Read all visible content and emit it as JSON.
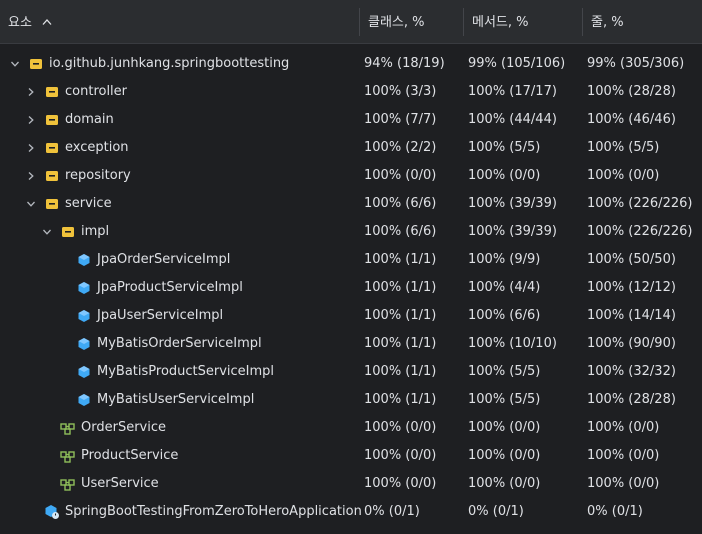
{
  "header": {
    "element_label": "요소",
    "class_label": "클래스, %",
    "method_label": "메서드, %",
    "line_label": "줄, %"
  },
  "rows": [
    {
      "label": "io.github.junhkang.springboottesting",
      "cls": "94% (18/19)",
      "meth": "99% (105/106)",
      "line": "99% (305/306)",
      "icon": "package-icon",
      "depth": 0,
      "chevron": "expanded"
    },
    {
      "label": "controller",
      "cls": "100% (3/3)",
      "meth": "100% (17/17)",
      "line": "100% (28/28)",
      "icon": "package-icon",
      "depth": 1,
      "chevron": "collapsed"
    },
    {
      "label": "domain",
      "cls": "100% (7/7)",
      "meth": "100% (44/44)",
      "line": "100% (46/46)",
      "icon": "package-icon",
      "depth": 1,
      "chevron": "collapsed"
    },
    {
      "label": "exception",
      "cls": "100% (2/2)",
      "meth": "100% (5/5)",
      "line": "100% (5/5)",
      "icon": "package-icon",
      "depth": 1,
      "chevron": "collapsed"
    },
    {
      "label": "repository",
      "cls": "100% (0/0)",
      "meth": "100% (0/0)",
      "line": "100% (0/0)",
      "icon": "package-icon",
      "depth": 1,
      "chevron": "collapsed"
    },
    {
      "label": "service",
      "cls": "100% (6/6)",
      "meth": "100% (39/39)",
      "line": "100% (226/226)",
      "icon": "package-icon",
      "depth": 1,
      "chevron": "expanded"
    },
    {
      "label": "impl",
      "cls": "100% (6/6)",
      "meth": "100% (39/39)",
      "line": "100% (226/226)",
      "icon": "package-icon",
      "depth": 2,
      "chevron": "expanded"
    },
    {
      "label": "JpaOrderServiceImpl",
      "cls": "100% (1/1)",
      "meth": "100% (9/9)",
      "line": "100% (50/50)",
      "icon": "class-icon",
      "depth": 3,
      "chevron": "none"
    },
    {
      "label": "JpaProductServiceImpl",
      "cls": "100% (1/1)",
      "meth": "100% (4/4)",
      "line": "100% (12/12)",
      "icon": "class-icon",
      "depth": 3,
      "chevron": "none"
    },
    {
      "label": "JpaUserServiceImpl",
      "cls": "100% (1/1)",
      "meth": "100% (6/6)",
      "line": "100% (14/14)",
      "icon": "class-icon",
      "depth": 3,
      "chevron": "none"
    },
    {
      "label": "MyBatisOrderServiceImpl",
      "cls": "100% (1/1)",
      "meth": "100% (10/10)",
      "line": "100% (90/90)",
      "icon": "class-icon",
      "depth": 3,
      "chevron": "none"
    },
    {
      "label": "MyBatisProductServiceImpl",
      "cls": "100% (1/1)",
      "meth": "100% (5/5)",
      "line": "100% (32/32)",
      "icon": "class-icon",
      "depth": 3,
      "chevron": "none"
    },
    {
      "label": "MyBatisUserServiceImpl",
      "cls": "100% (1/1)",
      "meth": "100% (5/5)",
      "line": "100% (28/28)",
      "icon": "class-icon",
      "depth": 3,
      "chevron": "none"
    },
    {
      "label": "OrderService",
      "cls": "100% (0/0)",
      "meth": "100% (0/0)",
      "line": "100% (0/0)",
      "icon": "interface-icon",
      "depth": 2,
      "chevron": "none"
    },
    {
      "label": "ProductService",
      "cls": "100% (0/0)",
      "meth": "100% (0/0)",
      "line": "100% (0/0)",
      "icon": "interface-icon",
      "depth": 2,
      "chevron": "none"
    },
    {
      "label": "UserService",
      "cls": "100% (0/0)",
      "meth": "100% (0/0)",
      "line": "100% (0/0)",
      "icon": "interface-icon",
      "depth": 2,
      "chevron": "none"
    },
    {
      "label": "SpringBootTestingFromZeroToHeroApplication",
      "cls": "0% (0/1)",
      "meth": "0% (0/1)",
      "line": "0% (0/1)",
      "icon": "spring-app-icon",
      "depth": 1,
      "chevron": "none"
    }
  ],
  "colors": {
    "package": "#f0c23b",
    "class": "#3fa9f5",
    "interface": "#8fbf5a",
    "text": "#dfe1e5"
  }
}
